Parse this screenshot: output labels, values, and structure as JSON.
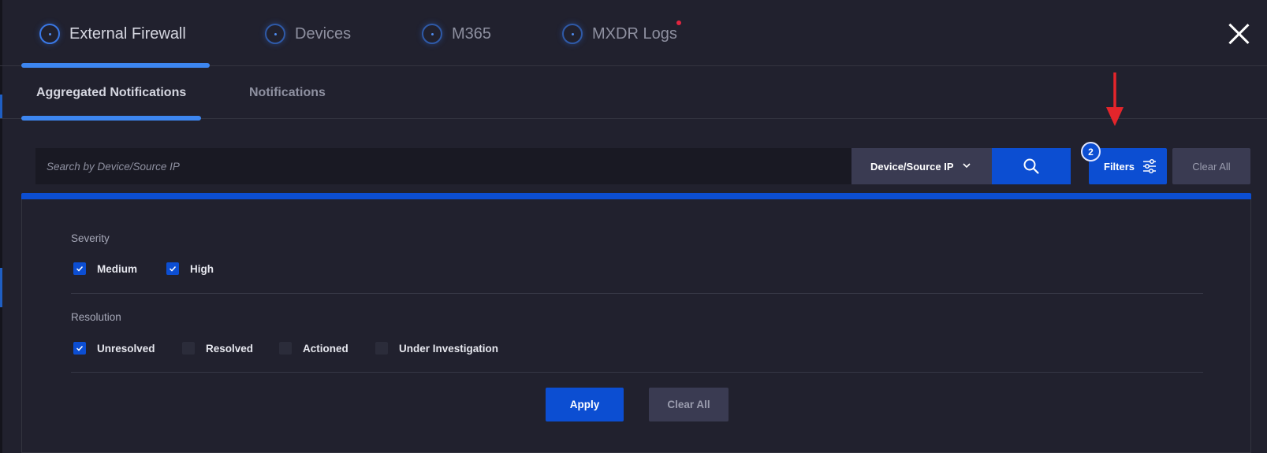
{
  "top_tabs": [
    {
      "label": "External Firewall",
      "active": true,
      "icon": "radar-icon"
    },
    {
      "label": "Devices",
      "active": false,
      "icon": "radar-icon"
    },
    {
      "label": "M365",
      "active": false,
      "icon": "radar-icon"
    },
    {
      "label": "MXDR Logs",
      "active": false,
      "icon": "radar-icon",
      "notification_dot": true
    }
  ],
  "close_icon": "close-icon",
  "sub_tabs": [
    {
      "label": "Aggregated Notifications",
      "active": true
    },
    {
      "label": "Notifications",
      "active": false
    }
  ],
  "search": {
    "placeholder": "Search by Device/Source IP",
    "field_select": "Device/Source IP",
    "search_icon": "search-icon",
    "filters_label": "Filters",
    "filters_icon": "sliders-icon",
    "filters_count": "2",
    "clear_label": "Clear All"
  },
  "filters": {
    "severity": {
      "label": "Severity",
      "options": [
        {
          "label": "Medium",
          "checked": true
        },
        {
          "label": "High",
          "checked": true
        }
      ]
    },
    "resolution": {
      "label": "Resolution",
      "options": [
        {
          "label": "Unresolved",
          "checked": true
        },
        {
          "label": "Resolved",
          "checked": false
        },
        {
          "label": "Actioned",
          "checked": false
        },
        {
          "label": "Under Investigation",
          "checked": false
        }
      ]
    },
    "apply_label": "Apply",
    "clear_label": "Clear All"
  },
  "colors": {
    "background": "#21212e",
    "accent": "#0c4ed2",
    "tab_underline": "#3d86f0",
    "notification_dot": "#e2253f",
    "annotation_arrow": "#e4252b"
  }
}
